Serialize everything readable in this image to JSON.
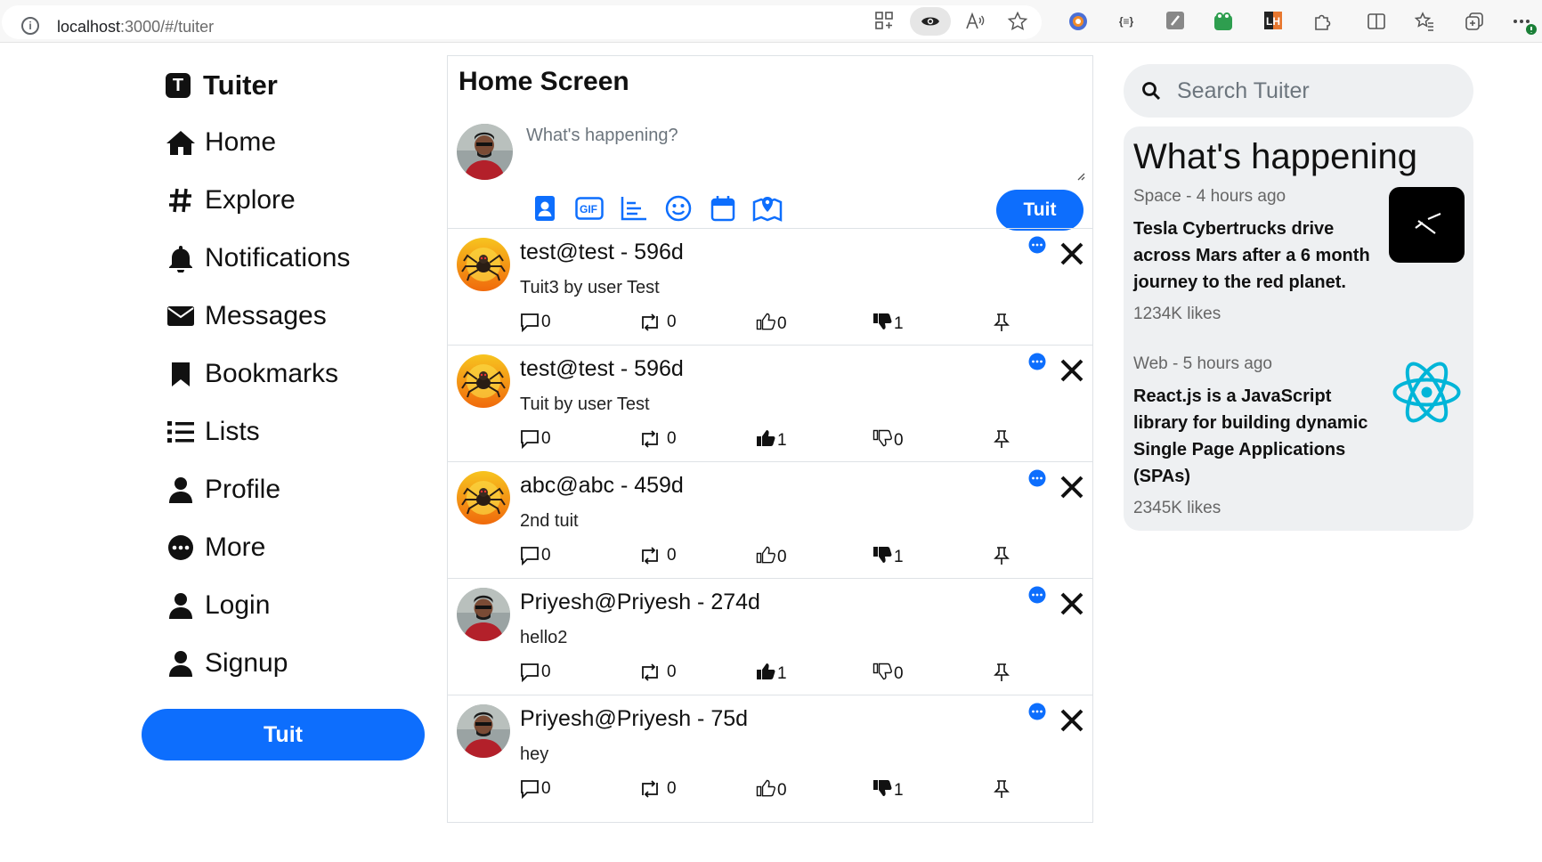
{
  "browser": {
    "url_host": "localhost",
    "url_path": ":3000/#/tuiter",
    "info_icon": "i"
  },
  "nav": {
    "brand": "Tuiter",
    "brand_letter": "T",
    "items": [
      {
        "label": "Home",
        "icon": "home-icon"
      },
      {
        "label": "Explore",
        "icon": "hashtag-icon"
      },
      {
        "label": "Notifications",
        "icon": "bell-icon"
      },
      {
        "label": "Messages",
        "icon": "envelope-icon"
      },
      {
        "label": "Bookmarks",
        "icon": "bookmark-icon"
      },
      {
        "label": "Lists",
        "icon": "list-icon"
      },
      {
        "label": "Profile",
        "icon": "user-icon"
      },
      {
        "label": "More",
        "icon": "more-icon"
      },
      {
        "label": "Login",
        "icon": "user-icon"
      },
      {
        "label": "Signup",
        "icon": "user-icon"
      }
    ],
    "tuit_button": "Tuit"
  },
  "home": {
    "title": "Home Screen",
    "compose_placeholder": "What's happening?",
    "tuit_button": "Tuit",
    "compose_icons": [
      "contact-card-icon",
      "gif-icon",
      "chart-icon",
      "smile-icon",
      "calendar-icon",
      "map-icon"
    ]
  },
  "tuits": [
    {
      "handle": "test@test - 596d",
      "text": "Tuit3 by user Test",
      "avatar": "spider",
      "replies": "0",
      "retuits": "0",
      "likes": "0",
      "liked": false,
      "dislikes": "1",
      "disliked": true
    },
    {
      "handle": "test@test - 596d",
      "text": "Tuit by user Test",
      "avatar": "spider",
      "replies": "0",
      "retuits": "0",
      "likes": "1",
      "liked": true,
      "dislikes": "0",
      "disliked": false
    },
    {
      "handle": "abc@abc - 459d",
      "text": "2nd tuit",
      "avatar": "spider",
      "replies": "0",
      "retuits": "0",
      "likes": "0",
      "liked": false,
      "dislikes": "1",
      "disliked": true
    },
    {
      "handle": "Priyesh@Priyesh - 274d",
      "text": "hello2",
      "avatar": "person",
      "replies": "0",
      "retuits": "0",
      "likes": "1",
      "liked": true,
      "dislikes": "0",
      "disliked": false
    },
    {
      "handle": "Priyesh@Priyesh - 75d",
      "text": "hey",
      "avatar": "person",
      "replies": "0",
      "retuits": "0",
      "likes": "0",
      "liked": false,
      "dislikes": "1",
      "disliked": true
    }
  ],
  "search": {
    "placeholder": "Search Tuiter"
  },
  "whats_happening": {
    "title": "What's happening",
    "trends": [
      {
        "meta": "Space - 4 hours ago",
        "headline": "Tesla Cybertrucks drive across Mars after a 6 month journey to the red planet.",
        "likes": "1234K likes",
        "image": "spacex-logo"
      },
      {
        "meta": "Web - 5 hours ago",
        "headline": "React.js is a JavaScript library for building dynamic Single Page Applications (SPAs)",
        "likes": "2345K likes",
        "image": "react-logo"
      }
    ]
  },
  "colors": {
    "accent": "#0d6efd",
    "panel": "#eef0f2",
    "border": "#dee2e6"
  }
}
